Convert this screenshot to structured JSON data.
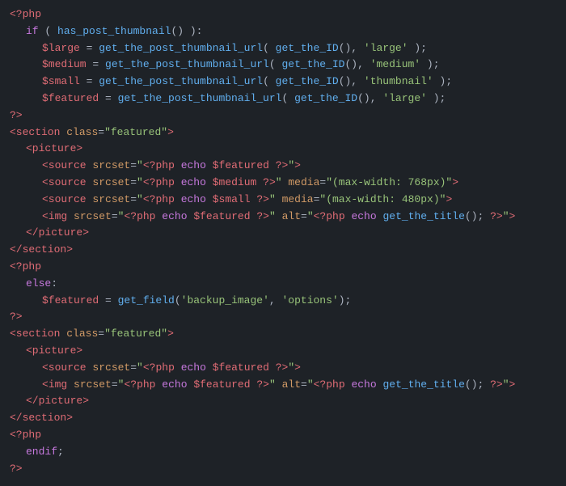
{
  "code": {
    "lines": [
      {
        "id": 1,
        "content": "php_open"
      },
      {
        "id": 2,
        "content": "if_has_thumbnail"
      },
      {
        "id": 3,
        "content": "large_var"
      },
      {
        "id": 4,
        "content": "medium_var"
      },
      {
        "id": 5,
        "content": "small_var"
      },
      {
        "id": 6,
        "content": "featured_var"
      },
      {
        "id": 7,
        "content": "php_close"
      },
      {
        "id": 8,
        "content": "section_featured_open"
      },
      {
        "id": 9,
        "content": "picture_open"
      },
      {
        "id": 10,
        "content": "source_featured"
      },
      {
        "id": 11,
        "content": "source_medium"
      },
      {
        "id": 12,
        "content": "source_small"
      },
      {
        "id": 13,
        "content": "img_featured"
      },
      {
        "id": 14,
        "content": "picture_close"
      },
      {
        "id": 15,
        "content": "section_close"
      },
      {
        "id": 16,
        "content": "php_open2"
      },
      {
        "id": 17,
        "content": "else"
      },
      {
        "id": 18,
        "content": "featured_get_field"
      },
      {
        "id": 19,
        "content": "php_close2"
      },
      {
        "id": 20,
        "content": "section_featured_open2"
      },
      {
        "id": 21,
        "content": "picture_open2"
      },
      {
        "id": 22,
        "content": "source_featured2"
      },
      {
        "id": 23,
        "content": "img_featured2"
      },
      {
        "id": 24,
        "content": "picture_close2"
      },
      {
        "id": 25,
        "content": "section_close2"
      },
      {
        "id": 26,
        "content": "php_open3"
      },
      {
        "id": 27,
        "content": "endif"
      },
      {
        "id": 28,
        "content": "php_close3"
      }
    ]
  }
}
